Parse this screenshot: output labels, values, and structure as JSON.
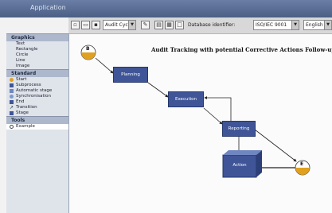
{
  "window": {
    "title": "Application"
  },
  "toolbar": {
    "cycle_select": "Audit Cycle",
    "standard_label": "Database identifier:",
    "standard_select": "ISO/IEC 9001",
    "language_select": "English"
  },
  "sidebar": {
    "sections": [
      {
        "heading": "Graphics",
        "items": [
          "Text",
          "Rectangle",
          "Circle",
          "Line",
          "Image"
        ]
      },
      {
        "heading": "Standard",
        "items": [
          "Start",
          "Subprocess",
          "Automatic stage",
          "Synchronisation",
          "End",
          "Transition",
          "Stage"
        ]
      },
      {
        "heading": "Tools",
        "items": [
          "Example"
        ]
      }
    ]
  },
  "diagram": {
    "title": "Audit Tracking with potential Corrective Actions Follow-up",
    "start_label": "B",
    "end_label": "E",
    "nodes": [
      "Planning",
      "Execution",
      "Reporting",
      "Action"
    ]
  }
}
